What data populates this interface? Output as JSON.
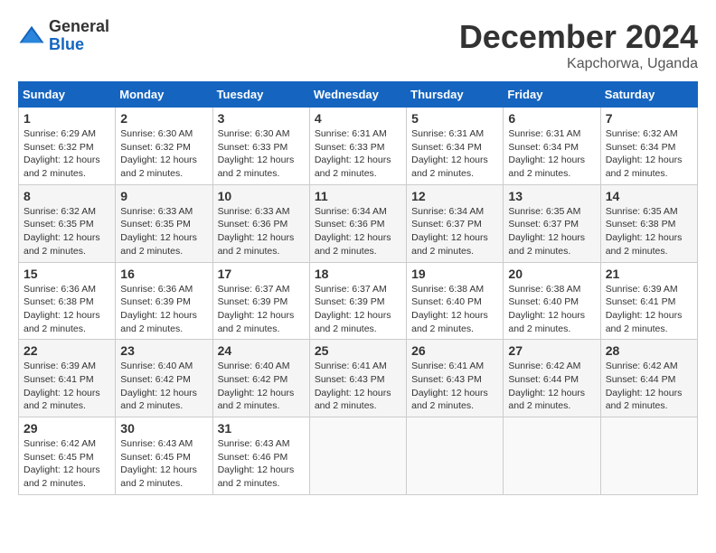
{
  "logo": {
    "general": "General",
    "blue": "Blue"
  },
  "title": {
    "month": "December 2024",
    "location": "Kapchorwa, Uganda"
  },
  "weekdays": [
    "Sunday",
    "Monday",
    "Tuesday",
    "Wednesday",
    "Thursday",
    "Friday",
    "Saturday"
  ],
  "weeks": [
    [
      {
        "day": "1",
        "sunrise": "6:29 AM",
        "sunset": "6:32 PM",
        "daylight": "12 hours and 2 minutes."
      },
      {
        "day": "2",
        "sunrise": "6:30 AM",
        "sunset": "6:32 PM",
        "daylight": "12 hours and 2 minutes."
      },
      {
        "day": "3",
        "sunrise": "6:30 AM",
        "sunset": "6:33 PM",
        "daylight": "12 hours and 2 minutes."
      },
      {
        "day": "4",
        "sunrise": "6:31 AM",
        "sunset": "6:33 PM",
        "daylight": "12 hours and 2 minutes."
      },
      {
        "day": "5",
        "sunrise": "6:31 AM",
        "sunset": "6:34 PM",
        "daylight": "12 hours and 2 minutes."
      },
      {
        "day": "6",
        "sunrise": "6:31 AM",
        "sunset": "6:34 PM",
        "daylight": "12 hours and 2 minutes."
      },
      {
        "day": "7",
        "sunrise": "6:32 AM",
        "sunset": "6:34 PM",
        "daylight": "12 hours and 2 minutes."
      }
    ],
    [
      {
        "day": "8",
        "sunrise": "6:32 AM",
        "sunset": "6:35 PM",
        "daylight": "12 hours and 2 minutes."
      },
      {
        "day": "9",
        "sunrise": "6:33 AM",
        "sunset": "6:35 PM",
        "daylight": "12 hours and 2 minutes."
      },
      {
        "day": "10",
        "sunrise": "6:33 AM",
        "sunset": "6:36 PM",
        "daylight": "12 hours and 2 minutes."
      },
      {
        "day": "11",
        "sunrise": "6:34 AM",
        "sunset": "6:36 PM",
        "daylight": "12 hours and 2 minutes."
      },
      {
        "day": "12",
        "sunrise": "6:34 AM",
        "sunset": "6:37 PM",
        "daylight": "12 hours and 2 minutes."
      },
      {
        "day": "13",
        "sunrise": "6:35 AM",
        "sunset": "6:37 PM",
        "daylight": "12 hours and 2 minutes."
      },
      {
        "day": "14",
        "sunrise": "6:35 AM",
        "sunset": "6:38 PM",
        "daylight": "12 hours and 2 minutes."
      }
    ],
    [
      {
        "day": "15",
        "sunrise": "6:36 AM",
        "sunset": "6:38 PM",
        "daylight": "12 hours and 2 minutes."
      },
      {
        "day": "16",
        "sunrise": "6:36 AM",
        "sunset": "6:39 PM",
        "daylight": "12 hours and 2 minutes."
      },
      {
        "day": "17",
        "sunrise": "6:37 AM",
        "sunset": "6:39 PM",
        "daylight": "12 hours and 2 minutes."
      },
      {
        "day": "18",
        "sunrise": "6:37 AM",
        "sunset": "6:39 PM",
        "daylight": "12 hours and 2 minutes."
      },
      {
        "day": "19",
        "sunrise": "6:38 AM",
        "sunset": "6:40 PM",
        "daylight": "12 hours and 2 minutes."
      },
      {
        "day": "20",
        "sunrise": "6:38 AM",
        "sunset": "6:40 PM",
        "daylight": "12 hours and 2 minutes."
      },
      {
        "day": "21",
        "sunrise": "6:39 AM",
        "sunset": "6:41 PM",
        "daylight": "12 hours and 2 minutes."
      }
    ],
    [
      {
        "day": "22",
        "sunrise": "6:39 AM",
        "sunset": "6:41 PM",
        "daylight": "12 hours and 2 minutes."
      },
      {
        "day": "23",
        "sunrise": "6:40 AM",
        "sunset": "6:42 PM",
        "daylight": "12 hours and 2 minutes."
      },
      {
        "day": "24",
        "sunrise": "6:40 AM",
        "sunset": "6:42 PM",
        "daylight": "12 hours and 2 minutes."
      },
      {
        "day": "25",
        "sunrise": "6:41 AM",
        "sunset": "6:43 PM",
        "daylight": "12 hours and 2 minutes."
      },
      {
        "day": "26",
        "sunrise": "6:41 AM",
        "sunset": "6:43 PM",
        "daylight": "12 hours and 2 minutes."
      },
      {
        "day": "27",
        "sunrise": "6:42 AM",
        "sunset": "6:44 PM",
        "daylight": "12 hours and 2 minutes."
      },
      {
        "day": "28",
        "sunrise": "6:42 AM",
        "sunset": "6:44 PM",
        "daylight": "12 hours and 2 minutes."
      }
    ],
    [
      {
        "day": "29",
        "sunrise": "6:42 AM",
        "sunset": "6:45 PM",
        "daylight": "12 hours and 2 minutes."
      },
      {
        "day": "30",
        "sunrise": "6:43 AM",
        "sunset": "6:45 PM",
        "daylight": "12 hours and 2 minutes."
      },
      {
        "day": "31",
        "sunrise": "6:43 AM",
        "sunset": "6:46 PM",
        "daylight": "12 hours and 2 minutes."
      },
      null,
      null,
      null,
      null
    ]
  ],
  "labels": {
    "sunrise": "Sunrise:",
    "sunset": "Sunset:",
    "daylight": "Daylight:"
  }
}
